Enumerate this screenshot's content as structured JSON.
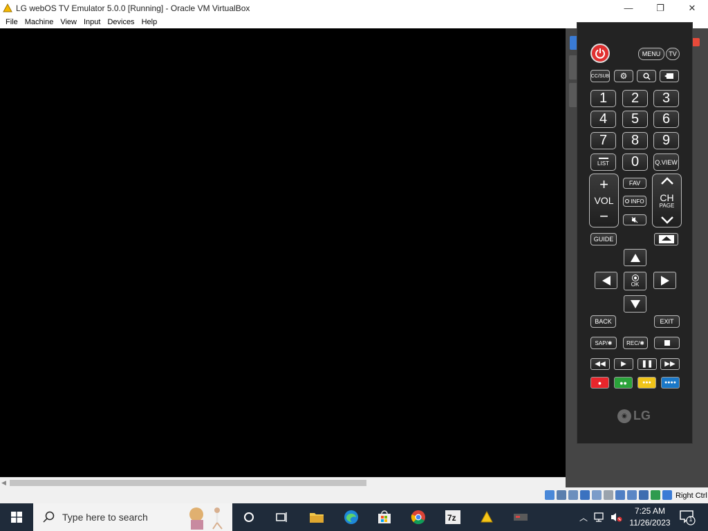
{
  "window": {
    "title": "LG webOS TV Emulator 5.0.0 [Running] - Oracle VM VirtualBox",
    "controls": {
      "minimize": "—",
      "maximize": "❐",
      "close": "✕"
    }
  },
  "menu": [
    "File",
    "Machine",
    "View",
    "Input",
    "Devices",
    "Help"
  ],
  "status_bar": {
    "host_key": "Right Ctrl"
  },
  "remote": {
    "menu": "MENU",
    "tv": "TV",
    "cc_sub": "CC/SUB",
    "digits": [
      "1",
      "2",
      "3",
      "4",
      "5",
      "6",
      "7",
      "8",
      "9",
      "0"
    ],
    "list": "LIST",
    "qview": "Q.VIEW",
    "vol": "VOL",
    "ch": "CH",
    "page": "PAGE",
    "fav": "FAV",
    "info": "INFO",
    "guide": "GUIDE",
    "ok": "OK",
    "back": "BACK",
    "exit": "EXIT",
    "sap": "SAP/✱",
    "rec": "REC/✱",
    "brand": "LG",
    "colors": {
      "red": "#e8262c",
      "green": "#2aa33a",
      "yellow": "#f0c419",
      "blue": "#1a78c8"
    }
  },
  "taskbar": {
    "search_placeholder": "Type here to search",
    "time": "7:25 AM",
    "date": "11/26/2023",
    "notification_count": "1"
  }
}
